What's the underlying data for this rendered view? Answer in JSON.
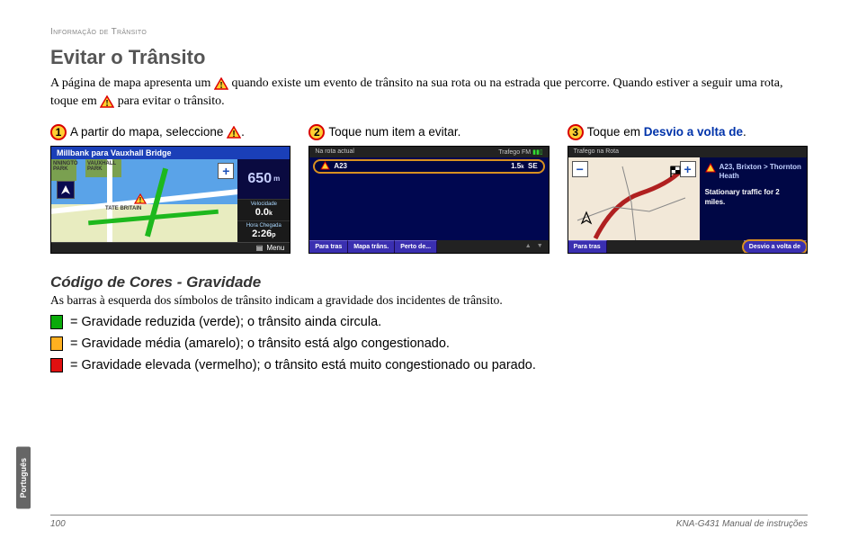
{
  "header_small": "Informação de Trânsito",
  "title": "Evitar o Trânsito",
  "intro_part1": "A página de mapa apresenta um ",
  "intro_part2": " quando existe um evento de trânsito na sua rota ou na estrada que percorre. Quando estiver a seguir uma rota, toque em ",
  "intro_part3": " para evitar o trânsito.",
  "steps": [
    {
      "num": "1",
      "text": "A partir do mapa, seleccione ",
      "has_triangle": true,
      "after": "."
    },
    {
      "num": "2",
      "text": "Toque num item a evitar."
    },
    {
      "num": "3",
      "text": "Toque em ",
      "bold_blue": "Desvio a volta de",
      "after": "."
    }
  ],
  "shot1": {
    "title": "Millbank para Vauxhall Bridge",
    "park1": "NNINGTO\nPARK",
    "park2": "VAUXHALL\nPARK",
    "tate": "TATE BRITAIN",
    "dist": "650",
    "dist_unit": "m",
    "speed_lbl": "Velocidade",
    "speed_val": "0.0",
    "speed_unit": "k",
    "eta_lbl": "Hora Chegada",
    "eta_val": "2:26",
    "eta_unit": "p",
    "menu": "Menu"
  },
  "shot2": {
    "top_left": "Na rota actual",
    "top_right": "Trafego FM",
    "row_code": "A23",
    "row_dist": "1.5",
    "row_unit": "k",
    "row_dir": "SE",
    "tabs": [
      "Para tras",
      "Mapa trâns.",
      "Perto de..."
    ]
  },
  "shot3": {
    "top": "Trafego na Rota",
    "side_line1": "A23, Brixton > Thornton Heath",
    "side_line2": "Stationary traffic for 2 miles.",
    "tab_left": "Para tras",
    "tab_right": "Desvio a volta de"
  },
  "section2_title": "Código de Cores - Gravidade",
  "section2_sub": "As barras à esquerda dos símbolos de trânsito indicam a gravidade dos incidentes de trânsito.",
  "legend": [
    {
      "color": "g",
      "text": " = Gravidade reduzida (verde); o trânsito ainda circula."
    },
    {
      "color": "y",
      "text": " = Gravidade média (amarelo); o trânsito está algo congestionado."
    },
    {
      "color": "r",
      "text": " = Gravidade elevada (vermelho); o trânsito está muito congestionado ou parado."
    }
  ],
  "lang_tab": "Português",
  "page_num": "100",
  "manual": "KNA-G431 Manual de instruções"
}
